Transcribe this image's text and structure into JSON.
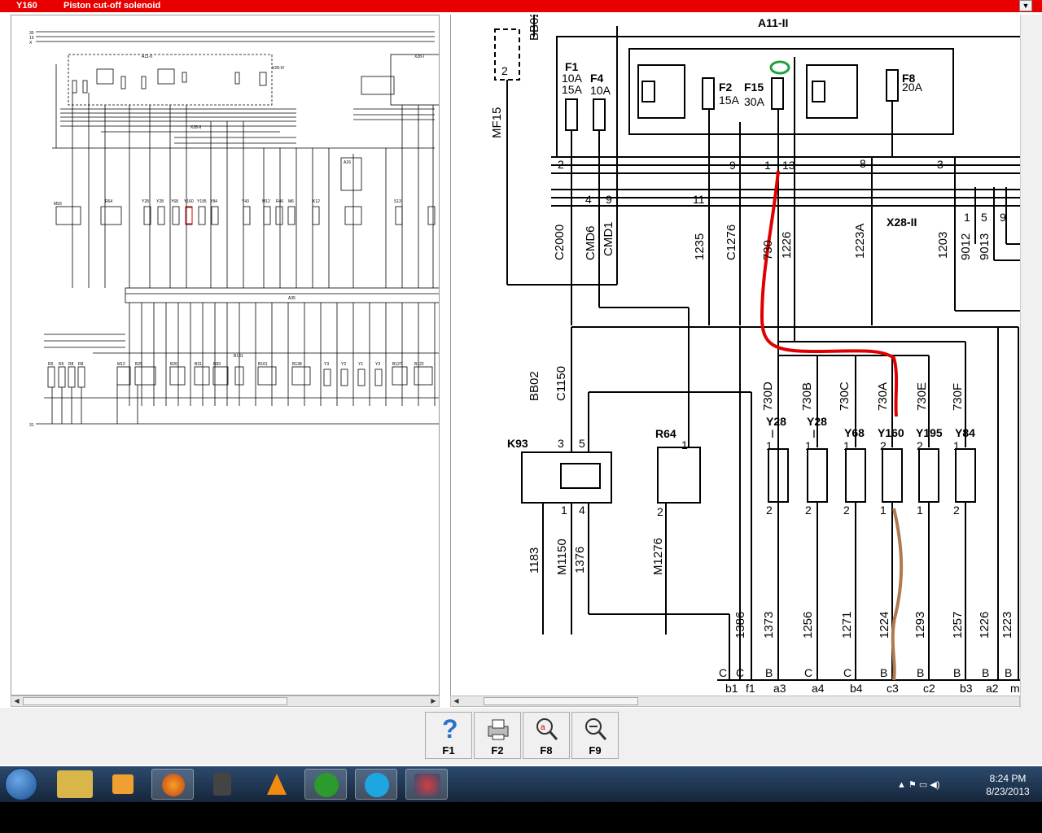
{
  "title": {
    "code": "Y160",
    "description": "Piston cut-off solenoid"
  },
  "toolbar": [
    {
      "key": "F1",
      "icon": "help-icon"
    },
    {
      "key": "F2",
      "icon": "printer-icon"
    },
    {
      "key": "F8",
      "icon": "zoom-text-icon"
    },
    {
      "key": "F9",
      "icon": "zoom-icon"
    }
  ],
  "taskbar": {
    "apps": [
      "file-explorer-icon",
      "media-player-icon",
      "firefox-icon",
      "tanks-game-icon",
      "vlc-icon",
      "utorrent-icon",
      "skype-icon",
      "diagnostic-app-icon"
    ],
    "time": "8:24 PM",
    "date": "8/23/2013"
  },
  "right_diagram": {
    "relay_box": "A11-II",
    "fuses": [
      {
        "id": "F1",
        "rating_a": "10A",
        "rating_b": "15A"
      },
      {
        "id": "F4",
        "rating_a": "10A"
      },
      {
        "id": "F2",
        "rating_a": "15A"
      },
      {
        "id": "F15",
        "rating_a": "30A"
      },
      {
        "id": "F8",
        "rating_a": "20A"
      }
    ],
    "connector": "X28-II",
    "pin_numbers": [
      "2",
      "9",
      "1",
      "13",
      "8",
      "3",
      "4",
      "9",
      "11",
      "1",
      "5",
      "9"
    ],
    "wires_mid": [
      "C2000",
      "CMD6",
      "CMD1",
      "1235",
      "C1276",
      "730",
      "1226",
      "1223A",
      "1203",
      "9012",
      "9013"
    ],
    "wires_left": [
      "MF15",
      "BB02",
      "C1150"
    ],
    "branch_wires": [
      "730D",
      "730B",
      "730C",
      "730A",
      "730E",
      "730F"
    ],
    "components": [
      {
        "id": "K93",
        "sub": ""
      },
      {
        "id": "R64",
        "sub": ""
      },
      {
        "id": "Y28",
        "sub": "I"
      },
      {
        "id": "Y28",
        "sub": "II"
      },
      {
        "id": "Y68",
        "sub": ""
      },
      {
        "id": "Y160",
        "sub": ""
      },
      {
        "id": "Y195",
        "sub": ""
      },
      {
        "id": "Y84",
        "sub": ""
      }
    ],
    "bottom_wires": [
      "1183",
      "M1150",
      "1376",
      "M1276",
      "1386",
      "1373",
      "1256",
      "1271",
      "1224",
      "1293",
      "1257",
      "1226",
      "1223"
    ],
    "bottom_pins": [
      "b1",
      "f1",
      "a3",
      "a4",
      "b4",
      "c3",
      "c2",
      "b3",
      "a2",
      "m"
    ],
    "bottom_letters": [
      "C",
      "C",
      "B",
      "C",
      "C",
      "B",
      "B",
      "B",
      "B",
      "B"
    ],
    "pin_labels_k93": [
      "3",
      "5",
      "1",
      "4"
    ],
    "mf_label": "2"
  },
  "left_diagram": {
    "top_rails": [
      "30",
      "15",
      "X"
    ],
    "labels": [
      "S1",
      "A11-II",
      "F2",
      "F15",
      "F9",
      "F5",
      "F8",
      "X28-IV",
      "X28-I",
      "X28-II",
      "M93",
      "R64",
      "Y28",
      "Y28",
      "Y68",
      "Y160",
      "Y195",
      "Y84",
      "Y43",
      "M12",
      "R46",
      "R46",
      "M6",
      "K12",
      "A16",
      "S13",
      "A35",
      "A67",
      "R6",
      "R6",
      "R8",
      "R8",
      "M12",
      "B25",
      "B30",
      "B26",
      "B31",
      "B83",
      "B131",
      "B161",
      "B138",
      "Y3",
      "Y2",
      "Y1",
      "Y3",
      "B127",
      "B122",
      "31"
    ]
  }
}
